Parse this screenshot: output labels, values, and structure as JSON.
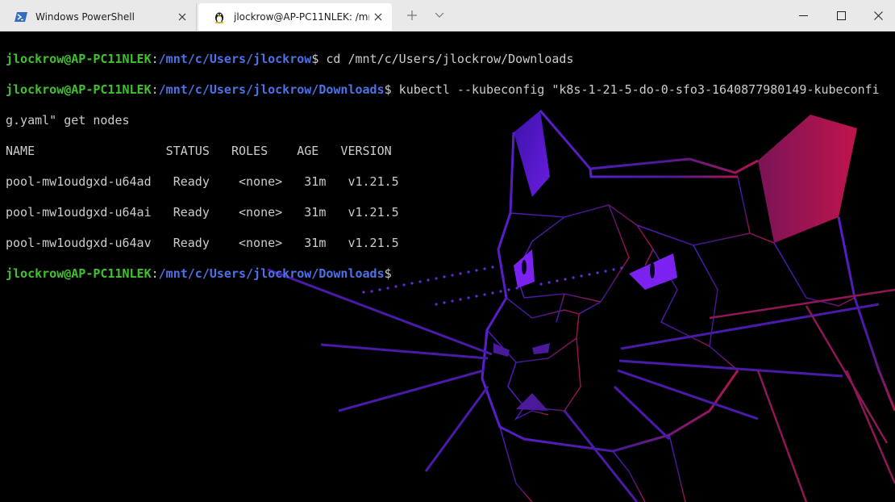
{
  "window": {
    "tabs": [
      {
        "label": "Windows PowerShell",
        "icon": "powershell-icon",
        "active": false
      },
      {
        "label": "jlockrow@AP-PC11NLEK: /mnt/",
        "icon": "tux-linux-icon",
        "active": true
      }
    ],
    "new_tab_symbol": "+",
    "dropdown_symbol": "⌄",
    "controls": {
      "minimize": "—",
      "maximize": "☐",
      "close": "✕"
    }
  },
  "terminal": {
    "colors": {
      "user": "#3fc22c",
      "path": "#4d72e8",
      "text": "#cccccc",
      "background": "#000000"
    },
    "prompt1": {
      "user": "jlockrow@AP-PC11NLEK",
      "colon": ":",
      "path": "/mnt/c/Users/jlockrow",
      "sign": "$",
      "command": " cd /mnt/c/Users/jlockrow/Downloads"
    },
    "prompt2": {
      "user": "jlockrow@AP-PC11NLEK",
      "colon": ":",
      "path": "/mnt/c/Users/jlockrow/Downloads",
      "sign": "$",
      "command": " kubectl --kubeconfig \"k8s-1-21-5-do-0-sfo3-1640877980149-kubeconfi"
    },
    "wrap_line": "g.yaml\" get nodes",
    "table": {
      "header": "NAME                  STATUS   ROLES    AGE   VERSION",
      "rows": [
        "pool-mw1oudgxd-u64ad   Ready    <none>   31m   v1.21.5",
        "pool-mw1oudgxd-u64ai   Ready    <none>   31m   v1.21.5",
        "pool-mw1oudgxd-u64av   Ready    <none>   31m   v1.21.5"
      ]
    },
    "prompt3": {
      "user": "jlockrow@AP-PC11NLEK",
      "colon": ":",
      "path": "/mnt/c/Users/jlockrow/Downloads",
      "sign": "$"
    }
  }
}
